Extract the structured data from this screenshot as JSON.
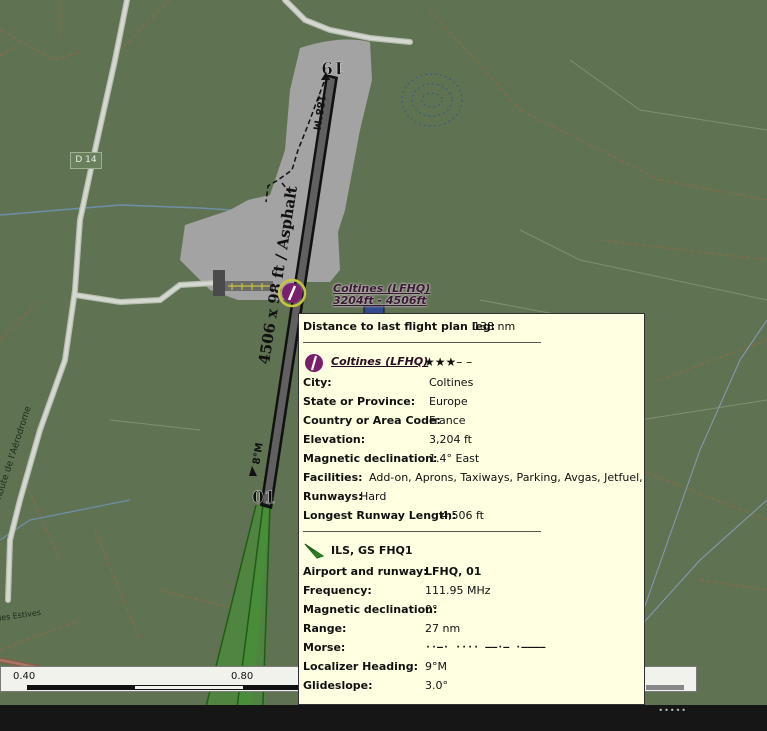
{
  "map": {
    "road_labels": {
      "d14": "D 14",
      "aerodrome": "Route de l'Aérodrome",
      "estives": "des Estives"
    },
    "runway": {
      "end_north": "19",
      "end_south": "01",
      "surface_label": "4506 x 98 ft / Asphalt",
      "heading_north": "188°M",
      "heading_south": "8°M"
    },
    "airport_label": {
      "name": "Coltines (LFHQ)",
      "sub": "3204ft - 4506ft"
    },
    "colors": {
      "grass": "#5f7352",
      "airport_area": "#a3a3a3",
      "runway": "#606060",
      "ils": "#2f7d1f",
      "airport_symbol": "#7a1f6b"
    }
  },
  "scale": {
    "ticks": [
      "0.40",
      "0.80"
    ]
  },
  "tooltip": {
    "distance": {
      "key": "Distance to last flight plan leg:",
      "value": "138 nm"
    },
    "airport": {
      "icon": "airport-symbol-icon",
      "name": "Coltines (LFHQ)",
      "stars": "★★★– –",
      "rows": [
        {
          "key": "City:",
          "value": "Coltines"
        },
        {
          "key": "State or Province:",
          "value": "Europe"
        },
        {
          "key": "Country or Area Code:",
          "value": "France"
        },
        {
          "key": "Elevation:",
          "value": "3,204 ft"
        },
        {
          "key": "Magnetic declination:",
          "value": "1.4° East"
        },
        {
          "key": "Facilities:",
          "value": "Add-on, Aprons, Taxiways, Parking, Avgas, Jetfuel, ILS"
        },
        {
          "key": "Runways:",
          "value": "Hard"
        },
        {
          "key": "Longest Runway Length:",
          "value": "4,506 ft"
        }
      ]
    },
    "ils": {
      "icon": "ils-feather-icon",
      "title": "ILS, GS FHQ1",
      "rows": [
        {
          "key": "Airport and runway:",
          "value": "LFHQ, 01"
        },
        {
          "key": "Frequency:",
          "value": "111.95 MHz"
        },
        {
          "key": "Magnetic declination:",
          "value": "0°"
        },
        {
          "key": "Range:",
          "value": "27 nm"
        },
        {
          "key": "Morse:",
          "value": "··–· ···· ––·– ·––––"
        },
        {
          "key": "Localizer Heading:",
          "value": "9°M"
        },
        {
          "key": "Glideslope:",
          "value": "3.0°"
        }
      ]
    }
  }
}
